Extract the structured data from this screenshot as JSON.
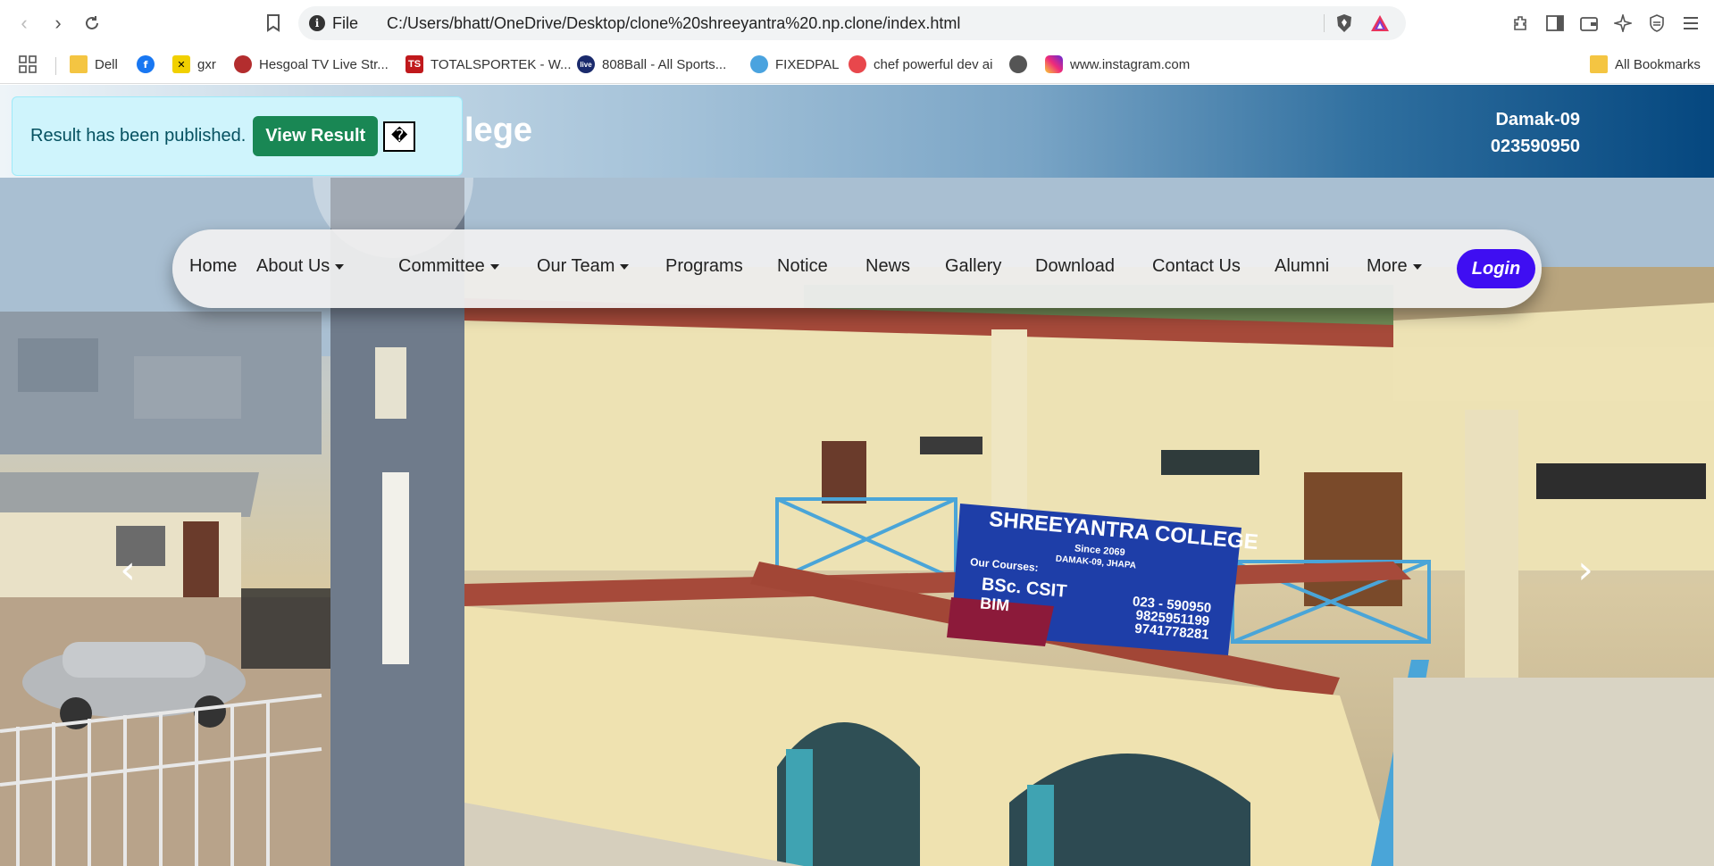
{
  "browser": {
    "scheme_label": "File",
    "url": "C:/Users/bhatt/OneDrive/Desktop/clone%20shreeyantra%20.np.clone/index.html",
    "bookmarks": [
      {
        "label": "Dell",
        "icon": "folder-icon"
      },
      {
        "label": "",
        "icon": "facebook-icon"
      },
      {
        "label": "gxr",
        "icon": "gxr-icon"
      },
      {
        "label": "Hesgoal TV Live Str...",
        "icon": "hesgoal-icon"
      },
      {
        "label": "TOTALSPORTEK - W...",
        "icon": "totalsportek-icon"
      },
      {
        "label": "808Ball - All Sports...",
        "icon": "808ball-icon"
      },
      {
        "label": "FIXEDPAL",
        "icon": "fixedpal-icon"
      },
      {
        "label": "chef powerful dev ai",
        "icon": "chef-icon"
      },
      {
        "label": "",
        "icon": "globe-icon"
      },
      {
        "label": "www.instagram.com",
        "icon": "instagram-icon"
      }
    ],
    "all_bookmarks_label": "All Bookmarks"
  },
  "alert": {
    "text": "Result has been published.",
    "button_label": "View Result",
    "close_glyph": "�"
  },
  "header": {
    "title_fragment": "lege",
    "address": "Damak-09",
    "phone": "023590950"
  },
  "nav": {
    "items": [
      {
        "label": "Home",
        "dropdown": false
      },
      {
        "label": "About Us",
        "dropdown": true
      },
      {
        "label": "Committee",
        "dropdown": true
      },
      {
        "label": "Our Team",
        "dropdown": true
      },
      {
        "label": "Programs",
        "dropdown": false
      },
      {
        "label": "Notice",
        "dropdown": false
      },
      {
        "label": "News",
        "dropdown": false
      },
      {
        "label": "Gallery",
        "dropdown": false
      },
      {
        "label": "Download",
        "dropdown": false
      },
      {
        "label": "Contact Us",
        "dropdown": false
      },
      {
        "label": "Alumni",
        "dropdown": false
      },
      {
        "label": "More",
        "dropdown": true
      }
    ],
    "login_label": "Login"
  },
  "hero": {
    "sign_title": "SHREEYANTRA COLLEGE",
    "sign_since": "Since 2069",
    "sign_location": "DAMAK-09, JHAPA",
    "sign_courses_label": "Our Courses:",
    "sign_course_1": "BSc. CSIT",
    "sign_course_2": "BIM",
    "sign_phone_1": "023 - 590950",
    "sign_phone_2": "9825951199",
    "sign_phone_3": "9741778281"
  },
  "colors": {
    "login_bg": "#3f0ef2",
    "alert_bg": "#cff4fc",
    "alert_button": "#198754",
    "header_dark": "#05477f"
  }
}
